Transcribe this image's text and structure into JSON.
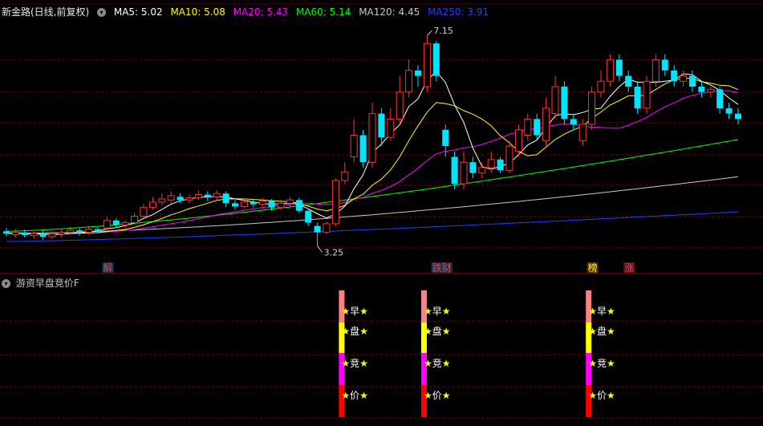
{
  "header": {
    "stock_title": "新金路(日线,前复权)",
    "ma_items": [
      {
        "label": "MA5: 5.02",
        "color": "#ffffff"
      },
      {
        "label": "MA10: 5.08",
        "color": "#ffff00"
      },
      {
        "label": "MA20: 5.43",
        "color": "#ff00ff"
      },
      {
        "label": "MA60: 5.14",
        "color": "#00ff00"
      },
      {
        "label": "MA120: 4.45",
        "color": "#c8c8c8"
      },
      {
        "label": "MA250: 3.91",
        "color": "#2040ff"
      }
    ]
  },
  "indicator_panel": {
    "title": "游资早盘竞价F",
    "star": "★",
    "chars": [
      "早",
      "盘",
      "竞",
      "价"
    ],
    "segment_colors": [
      "#ff8080",
      "#ffff00",
      "#ff00ff",
      "#ff0000"
    ]
  },
  "chart_data": {
    "type": "candlestick",
    "price_range": [
      2.9,
      7.3
    ],
    "annotations": [
      {
        "text": "7.15",
        "bar": 46,
        "price": 7.15
      },
      {
        "text": "3.25",
        "bar": 34,
        "price": 3.25
      }
    ],
    "event_tags": [
      {
        "text": "解",
        "bar": 11,
        "color": "#ff3c3c",
        "bg": "#003a5a"
      },
      {
        "text": "跌财",
        "bar": 47,
        "color": "#ff3c3c",
        "bg": "#003a5a"
      },
      {
        "text": "榜",
        "bar": 64,
        "color": "#ffff00",
        "bg": "#5a2a00"
      },
      {
        "text": "涨",
        "bar": 68,
        "color": "#ff3c3c",
        "bg": "#5a1020"
      }
    ],
    "signal_bars": [
      36,
      45,
      63
    ],
    "candles": [
      [
        3.52,
        3.48,
        3.58,
        3.42
      ],
      [
        3.46,
        3.5,
        3.56,
        3.4
      ],
      [
        3.5,
        3.45,
        3.55,
        3.4
      ],
      [
        3.44,
        3.48,
        3.52,
        3.38
      ],
      [
        3.48,
        3.42,
        3.54,
        3.36
      ],
      [
        3.42,
        3.47,
        3.52,
        3.38
      ],
      [
        3.47,
        3.5,
        3.56,
        3.42
      ],
      [
        3.5,
        3.54,
        3.6,
        3.46
      ],
      [
        3.54,
        3.5,
        3.58,
        3.44
      ],
      [
        3.5,
        3.56,
        3.62,
        3.46
      ],
      [
        3.56,
        3.52,
        3.6,
        3.48
      ],
      [
        3.58,
        3.72,
        3.78,
        3.54
      ],
      [
        3.72,
        3.64,
        3.76,
        3.58
      ],
      [
        3.64,
        3.68,
        3.72,
        3.58
      ],
      [
        3.68,
        3.8,
        3.86,
        3.64
      ],
      [
        3.8,
        3.96,
        4.02,
        3.78
      ],
      [
        3.96,
        4.06,
        4.16,
        3.92
      ],
      [
        4.06,
        4.12,
        4.22,
        4.0
      ],
      [
        4.1,
        4.18,
        4.26,
        4.04
      ],
      [
        4.16,
        4.1,
        4.22,
        4.04
      ],
      [
        4.1,
        4.14,
        4.2,
        4.04
      ],
      [
        4.14,
        4.2,
        4.28,
        4.1
      ],
      [
        4.2,
        4.16,
        4.26,
        4.08
      ],
      [
        4.16,
        4.22,
        4.28,
        4.1
      ],
      [
        4.22,
        4.04,
        4.26,
        3.96
      ],
      [
        4.04,
        3.98,
        4.1,
        3.92
      ],
      [
        3.98,
        4.06,
        4.12,
        3.94
      ],
      [
        4.06,
        4.02,
        4.12,
        3.96
      ],
      [
        4.02,
        4.08,
        4.14,
        3.98
      ],
      [
        4.08,
        3.96,
        4.12,
        3.9
      ],
      [
        3.96,
        4.04,
        4.1,
        3.92
      ],
      [
        4.04,
        4.1,
        4.16,
        3.98
      ],
      [
        4.1,
        3.9,
        4.14,
        3.86
      ],
      [
        3.9,
        3.68,
        3.94,
        3.62
      ],
      [
        3.62,
        3.5,
        3.68,
        3.25
      ],
      [
        3.5,
        3.66,
        3.7,
        3.46
      ],
      [
        3.66,
        4.46,
        4.5,
        3.62
      ],
      [
        4.46,
        4.62,
        4.8,
        4.4
      ],
      [
        4.9,
        5.3,
        5.6,
        4.8
      ],
      [
        5.3,
        4.8,
        5.4,
        4.7
      ],
      [
        4.8,
        5.7,
        5.9,
        4.7
      ],
      [
        5.7,
        5.26,
        5.8,
        5.1
      ],
      [
        5.26,
        5.6,
        5.8,
        5.2
      ],
      [
        5.6,
        6.1,
        6.4,
        5.5
      ],
      [
        6.1,
        6.5,
        6.7,
        6.0
      ],
      [
        6.5,
        6.4,
        6.6,
        6.2
      ],
      [
        6.2,
        7.0,
        7.15,
        6.1
      ],
      [
        7.0,
        6.4,
        7.05,
        6.3
      ],
      [
        5.4,
        5.1,
        5.5,
        4.9
      ],
      [
        4.9,
        4.4,
        5.0,
        4.3
      ],
      [
        4.4,
        4.8,
        5.0,
        4.3
      ],
      [
        4.8,
        4.6,
        4.9,
        4.5
      ],
      [
        4.6,
        4.7,
        4.8,
        4.5
      ],
      [
        4.7,
        4.85,
        5.0,
        4.6
      ],
      [
        4.85,
        4.65,
        4.9,
        4.6
      ],
      [
        4.65,
        5.1,
        5.2,
        4.6
      ],
      [
        5.0,
        5.4,
        5.5,
        4.9
      ],
      [
        5.3,
        5.6,
        5.7,
        5.2
      ],
      [
        5.6,
        5.3,
        5.7,
        5.2
      ],
      [
        5.2,
        5.8,
        6.0,
        5.1
      ],
      [
        5.7,
        6.2,
        6.4,
        5.6
      ],
      [
        6.2,
        5.6,
        6.3,
        5.5
      ],
      [
        5.6,
        5.5,
        5.7,
        5.4
      ],
      [
        5.2,
        5.5,
        5.6,
        5.1
      ],
      [
        5.5,
        6.1,
        6.2,
        5.4
      ],
      [
        6.1,
        6.3,
        6.5,
        6.0
      ],
      [
        6.3,
        6.7,
        6.8,
        6.2
      ],
      [
        6.7,
        6.4,
        6.8,
        6.3
      ],
      [
        6.4,
        6.2,
        6.5,
        6.1
      ],
      [
        6.2,
        5.8,
        6.3,
        5.7
      ],
      [
        5.8,
        6.3,
        6.4,
        5.7
      ],
      [
        6.3,
        6.7,
        6.8,
        6.2
      ],
      [
        6.7,
        6.5,
        6.8,
        6.4
      ],
      [
        6.5,
        6.3,
        6.6,
        6.2
      ],
      [
        6.3,
        6.4,
        6.5,
        6.2
      ],
      [
        6.4,
        6.2,
        6.5,
        6.1
      ],
      [
        6.2,
        6.1,
        6.3,
        6.0
      ],
      [
        6.1,
        6.15,
        6.2,
        6.0
      ],
      [
        6.15,
        5.8,
        6.2,
        5.7
      ],
      [
        5.8,
        5.7,
        5.9,
        5.6
      ],
      [
        5.7,
        5.6,
        5.8,
        5.5
      ]
    ]
  }
}
